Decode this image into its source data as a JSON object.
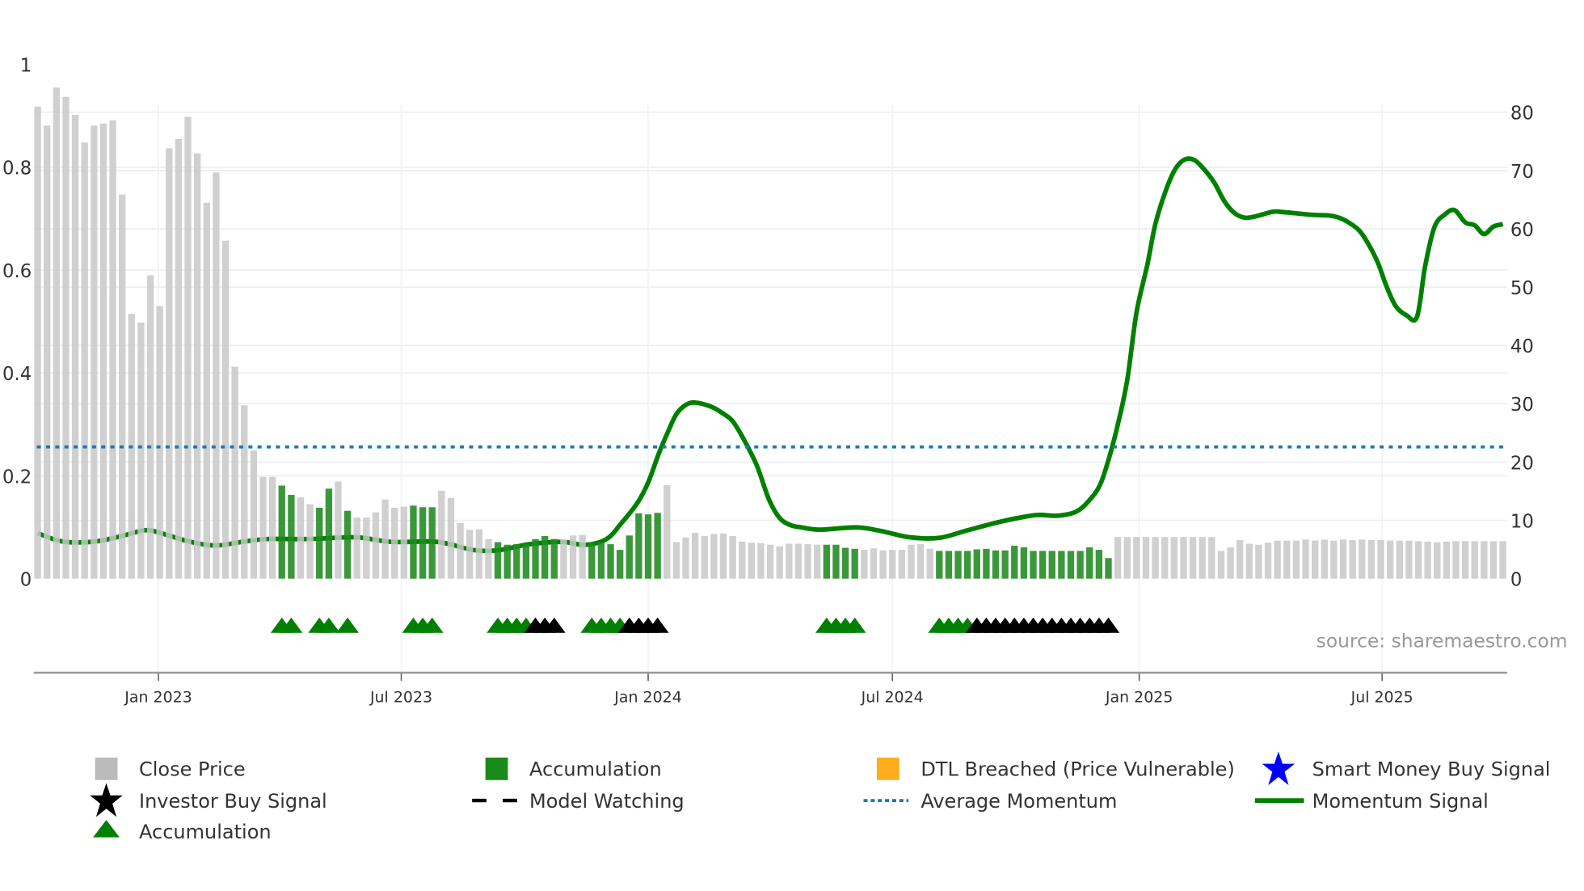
{
  "chart_data": {
    "type": "bar+line",
    "title": "",
    "source": "source: sharemaestro.com",
    "grid": true,
    "legend_placement": "bottom",
    "colors": {
      "close_price": "#c8c8c8",
      "accumulation_bar": "#1f8a1f",
      "momentum_signal": "#008000",
      "average_momentum": "#1f77b4",
      "accumulation_marker": "#008000",
      "black_marker": "#000000",
      "dtl_breached": "#ffad1f",
      "smart_money": "#0000ff"
    },
    "y_left": {
      "range": [
        0,
        1
      ],
      "ticks": [
        0,
        0.2,
        0.4,
        0.6,
        0.8,
        1
      ],
      "tick_labels": [
        "0",
        "0.2",
        "0.4",
        "0.6",
        "0.8",
        "1"
      ]
    },
    "y_right": {
      "range": [
        0,
        88.2
      ],
      "ticks": [
        0,
        10,
        20,
        30,
        40,
        50,
        60,
        70,
        80
      ],
      "tick_labels": [
        "0",
        "10",
        "20",
        "30",
        "40",
        "50",
        "60",
        "70",
        "80"
      ]
    },
    "x_ticks": [
      {
        "date": "2023-01-01",
        "label": "Jan 2023"
      },
      {
        "date": "2023-07-01",
        "label": "Jul 2023"
      },
      {
        "date": "2024-01-01",
        "label": "Jan 2024"
      },
      {
        "date": "2024-07-01",
        "label": "Jul 2024"
      },
      {
        "date": "2025-01-01",
        "label": "Jan 2025"
      },
      {
        "date": "2025-07-01",
        "label": "Jul 2025"
      }
    ],
    "dates": [
      "2022-10-03",
      "2022-10-10",
      "2022-10-17",
      "2022-10-24",
      "2022-10-31",
      "2022-11-07",
      "2022-11-14",
      "2022-11-21",
      "2022-11-28",
      "2022-12-05",
      "2022-12-12",
      "2022-12-19",
      "2022-12-26",
      "2023-01-02",
      "2023-01-09",
      "2023-01-16",
      "2023-01-23",
      "2023-01-30",
      "2023-02-06",
      "2023-02-13",
      "2023-02-20",
      "2023-02-27",
      "2023-03-06",
      "2023-03-13",
      "2023-03-20",
      "2023-03-27",
      "2023-04-03",
      "2023-04-10",
      "2023-04-17",
      "2023-04-24",
      "2023-05-01",
      "2023-05-08",
      "2023-05-15",
      "2023-05-22",
      "2023-05-29",
      "2023-06-05",
      "2023-06-12",
      "2023-06-19",
      "2023-06-26",
      "2023-07-03",
      "2023-07-10",
      "2023-07-17",
      "2023-07-24",
      "2023-07-31",
      "2023-08-07",
      "2023-08-14",
      "2023-08-21",
      "2023-08-28",
      "2023-09-04",
      "2023-09-11",
      "2023-09-18",
      "2023-09-25",
      "2023-10-02",
      "2023-10-09",
      "2023-10-16",
      "2023-10-23",
      "2023-10-30",
      "2023-11-06",
      "2023-11-13",
      "2023-11-20",
      "2023-11-27",
      "2023-12-04",
      "2023-12-11",
      "2023-12-18",
      "2023-12-25",
      "2024-01-01",
      "2024-01-08",
      "2024-01-15",
      "2024-01-22",
      "2024-01-29",
      "2024-02-05",
      "2024-02-12",
      "2024-02-19",
      "2024-02-26",
      "2024-03-04",
      "2024-03-11",
      "2024-03-18",
      "2024-03-25",
      "2024-04-01",
      "2024-04-08",
      "2024-04-15",
      "2024-04-22",
      "2024-04-29",
      "2024-05-06",
      "2024-05-13",
      "2024-05-20",
      "2024-05-27",
      "2024-06-03",
      "2024-06-10",
      "2024-06-17",
      "2024-06-24",
      "2024-07-01",
      "2024-07-08",
      "2024-07-15",
      "2024-07-22",
      "2024-07-29",
      "2024-08-05",
      "2024-08-12",
      "2024-08-19",
      "2024-08-26",
      "2024-09-02",
      "2024-09-09",
      "2024-09-16",
      "2024-09-23",
      "2024-09-30",
      "2024-10-07",
      "2024-10-14",
      "2024-10-21",
      "2024-10-28",
      "2024-11-04",
      "2024-11-11",
      "2024-11-18",
      "2024-11-25",
      "2024-12-02",
      "2024-12-09",
      "2024-12-16",
      "2024-12-23",
      "2024-12-30",
      "2025-01-06",
      "2025-01-13",
      "2025-01-20",
      "2025-01-27",
      "2025-02-03",
      "2025-02-10",
      "2025-02-17",
      "2025-02-24",
      "2025-03-03",
      "2025-03-10",
      "2025-03-17",
      "2025-03-24",
      "2025-03-31",
      "2025-04-07",
      "2025-04-14",
      "2025-04-21",
      "2025-04-28",
      "2025-05-05",
      "2025-05-12",
      "2025-05-19",
      "2025-05-26",
      "2025-06-02",
      "2025-06-09",
      "2025-06-16",
      "2025-06-23",
      "2025-06-30",
      "2025-07-07",
      "2025-07-14",
      "2025-07-21",
      "2025-07-28",
      "2025-08-04",
      "2025-08-11",
      "2025-08-18",
      "2025-08-25",
      "2025-09-01",
      "2025-09-08",
      "2025-09-15",
      "2025-09-22",
      "2025-09-29"
    ],
    "close_price": [
      0.918,
      0.881,
      0.955,
      0.937,
      0.902,
      0.848,
      0.881,
      0.885,
      0.891,
      0.747,
      0.515,
      0.498,
      0.59,
      0.53,
      0.837,
      0.855,
      0.898,
      0.827,
      0.731,
      0.79,
      0.657,
      0.412,
      0.337,
      0.249,
      0.198,
      0.198,
      0.181,
      0.163,
      0.158,
      0.145,
      0.138,
      0.175,
      0.189,
      0.132,
      0.119,
      0.119,
      0.129,
      0.154,
      0.138,
      0.14,
      0.142,
      0.139,
      0.139,
      0.171,
      0.157,
      0.108,
      0.095,
      0.096,
      0.077,
      0.071,
      0.066,
      0.067,
      0.067,
      0.077,
      0.083,
      0.077,
      0.076,
      0.084,
      0.085,
      0.071,
      0.071,
      0.067,
      0.056,
      0.084,
      0.127,
      0.125,
      0.128,
      0.182,
      0.071,
      0.08,
      0.089,
      0.083,
      0.087,
      0.088,
      0.083,
      0.072,
      0.07,
      0.069,
      0.066,
      0.063,
      0.068,
      0.068,
      0.067,
      0.066,
      0.066,
      0.066,
      0.06,
      0.058,
      0.056,
      0.059,
      0.055,
      0.056,
      0.056,
      0.066,
      0.067,
      0.058,
      0.054,
      0.054,
      0.054,
      0.054,
      0.057,
      0.058,
      0.055,
      0.055,
      0.064,
      0.061,
      0.054,
      0.054,
      0.054,
      0.054,
      0.054,
      0.054,
      0.061,
      0.056,
      0.04,
      0.081,
      0.081,
      0.081,
      0.081,
      0.081,
      0.081,
      0.081,
      0.081,
      0.081,
      0.081,
      0.081,
      0.054,
      0.061,
      0.075,
      0.068,
      0.066,
      0.07,
      0.074,
      0.074,
      0.074,
      0.076,
      0.074,
      0.076,
      0.074,
      0.076,
      0.075,
      0.076,
      0.075,
      0.075,
      0.074,
      0.074,
      0.074,
      0.073,
      0.072,
      0.071,
      0.072,
      0.073,
      0.073,
      0.073,
      0.073,
      0.073,
      0.073
    ],
    "accumulation": [
      0,
      0,
      0,
      0,
      0,
      0,
      0,
      0,
      0,
      0,
      0,
      0,
      0,
      0,
      0,
      0,
      0,
      0,
      0,
      0,
      0,
      0,
      0,
      0,
      0,
      0,
      1,
      1,
      0,
      0,
      1,
      1,
      0,
      1,
      0,
      0,
      0,
      0,
      0,
      0,
      1,
      1,
      1,
      0,
      0,
      0,
      0,
      0,
      0,
      1,
      1,
      1,
      1,
      1,
      1,
      1,
      0,
      0,
      0,
      1,
      1,
      1,
      1,
      1,
      1,
      1,
      1,
      0,
      0,
      0,
      0,
      0,
      0,
      0,
      0,
      0,
      0,
      0,
      0,
      0,
      0,
      0,
      0,
      0,
      1,
      1,
      1,
      1,
      0,
      0,
      0,
      0,
      0,
      0,
      0,
      0,
      1,
      1,
      1,
      1,
      1,
      1,
      1,
      1,
      1,
      1,
      1,
      1,
      1,
      1,
      1,
      1,
      1,
      1,
      1,
      0,
      0,
      0,
      0,
      0,
      0,
      0,
      0,
      0,
      0,
      0,
      0,
      0,
      0,
      0,
      0,
      0,
      0,
      0,
      0,
      0,
      0,
      0,
      0,
      0,
      0,
      0,
      0,
      0,
      0,
      0,
      0,
      0,
      0,
      0,
      0,
      0,
      0,
      0,
      0,
      0,
      0
    ],
    "average_momentum": 22.6,
    "momentum_signal": [
      [
        "2022-10-03",
        7.8
      ],
      [
        "2022-10-21",
        6.4
      ],
      [
        "2022-11-12",
        6.3
      ],
      [
        "2022-12-01",
        7.1
      ],
      [
        "2022-12-22",
        8.3
      ],
      [
        "2023-01-03",
        7.8
      ],
      [
        "2023-01-25",
        6.3
      ],
      [
        "2023-02-13",
        5.7
      ],
      [
        "2023-03-04",
        6.3
      ],
      [
        "2023-03-23",
        6.8
      ],
      [
        "2023-04-24",
        6.8
      ],
      [
        "2023-05-28",
        7.1
      ],
      [
        "2023-06-24",
        6.3
      ],
      [
        "2023-07-28",
        6.3
      ],
      [
        "2023-08-24",
        4.9
      ],
      [
        "2023-09-12",
        4.9
      ],
      [
        "2023-10-04",
        5.9
      ],
      [
        "2023-10-29",
        6.3
      ],
      [
        "2023-11-15",
        5.8
      ],
      [
        "2023-12-01",
        6.8
      ],
      [
        "2023-12-12",
        9.5
      ],
      [
        "2023-12-24",
        13.0
      ],
      [
        "2024-01-01",
        16.5
      ],
      [
        "2024-01-09",
        21.5
      ],
      [
        "2024-01-16",
        25.3
      ],
      [
        "2024-01-22",
        28.2
      ],
      [
        "2024-01-29",
        29.8
      ],
      [
        "2024-02-05",
        30.2
      ],
      [
        "2024-02-17",
        29.5
      ],
      [
        "2024-02-26",
        28.3
      ],
      [
        "2024-03-04",
        27.0
      ],
      [
        "2024-03-12",
        24.0
      ],
      [
        "2024-03-22",
        19.4
      ],
      [
        "2024-03-31",
        13.6
      ],
      [
        "2024-04-08",
        10.4
      ],
      [
        "2024-04-16",
        9.2
      ],
      [
        "2024-04-24",
        8.8
      ],
      [
        "2024-05-08",
        8.4
      ],
      [
        "2024-06-04",
        8.8
      ],
      [
        "2024-06-22",
        8.2
      ],
      [
        "2024-07-14",
        7.1
      ],
      [
        "2024-08-05",
        7.0
      ],
      [
        "2024-08-26",
        8.3
      ],
      [
        "2024-09-22",
        9.9
      ],
      [
        "2024-10-16",
        10.9
      ],
      [
        "2024-11-01",
        10.8
      ],
      [
        "2024-11-15",
        11.5
      ],
      [
        "2024-11-25",
        13.5
      ],
      [
        "2024-12-03",
        16.2
      ],
      [
        "2024-12-10",
        21.1
      ],
      [
        "2024-12-16",
        26.4
      ],
      [
        "2024-12-23",
        34.0
      ],
      [
        "2024-12-30",
        45.7
      ],
      [
        "2025-01-07",
        53.8
      ],
      [
        "2025-01-13",
        60.8
      ],
      [
        "2025-01-21",
        66.7
      ],
      [
        "2025-01-28",
        70.3
      ],
      [
        "2025-02-04",
        71.9
      ],
      [
        "2025-02-11",
        71.8
      ],
      [
        "2025-02-18",
        70.3
      ],
      [
        "2025-02-26",
        67.9
      ],
      [
        "2025-03-05",
        64.9
      ],
      [
        "2025-03-12",
        62.9
      ],
      [
        "2025-03-19",
        62.0
      ],
      [
        "2025-03-26",
        62.0
      ],
      [
        "2025-04-10",
        62.9
      ],
      [
        "2025-04-17",
        62.9
      ],
      [
        "2025-05-10",
        62.4
      ],
      [
        "2025-05-22",
        62.3
      ],
      [
        "2025-05-30",
        61.9
      ],
      [
        "2025-06-06",
        61.1
      ],
      [
        "2025-06-14",
        59.7
      ],
      [
        "2025-06-21",
        57.3
      ],
      [
        "2025-06-28",
        54.1
      ],
      [
        "2025-07-04",
        50.3
      ],
      [
        "2025-07-11",
        46.8
      ],
      [
        "2025-07-19",
        45.2
      ],
      [
        "2025-07-27",
        44.9
      ],
      [
        "2025-08-02",
        53.5
      ],
      [
        "2025-08-09",
        60.3
      ],
      [
        "2025-08-17",
        62.5
      ],
      [
        "2025-08-24",
        63.2
      ],
      [
        "2025-09-01",
        61.1
      ],
      [
        "2025-09-08",
        60.6
      ],
      [
        "2025-09-15",
        59.1
      ],
      [
        "2025-09-22",
        60.4
      ],
      [
        "2025-09-29",
        60.8
      ]
    ],
    "accumulation_markers": [
      "2023-04-03",
      "2023-04-10",
      "2023-05-01",
      "2023-05-08",
      "2023-05-22",
      "2023-07-10",
      "2023-07-17",
      "2023-07-24",
      "2023-09-11",
      "2023-09-18",
      "2023-09-25",
      "2023-10-02",
      "2023-11-20",
      "2023-11-27",
      "2023-12-04",
      "2023-12-11",
      "2024-05-13",
      "2024-05-20",
      "2024-05-27",
      "2024-06-03",
      "2024-08-05",
      "2024-08-12",
      "2024-08-19",
      "2024-08-26"
    ],
    "black_markers": [
      "2023-10-09",
      "2023-10-16",
      "2023-10-23",
      "2023-12-18",
      "2023-12-25",
      "2024-01-01",
      "2024-01-08",
      "2024-09-02",
      "2024-09-09",
      "2024-09-16",
      "2024-09-23",
      "2024-09-30",
      "2024-10-07",
      "2024-10-14",
      "2024-10-21",
      "2024-10-28",
      "2024-11-04",
      "2024-11-11",
      "2024-11-18",
      "2024-11-25",
      "2024-12-02",
      "2024-12-09"
    ],
    "legend": [
      {
        "label": "Close Price",
        "icon": "grey-square"
      },
      {
        "label": "Accumulation",
        "icon": "green-square"
      },
      {
        "label": "DTL Breached (Price Vulnerable)",
        "icon": "orange-square"
      },
      {
        "label": "Smart Money Buy Signal",
        "icon": "blue-star"
      },
      {
        "label": "Investor Buy Signal",
        "icon": "black-star"
      },
      {
        "label": "Model Watching",
        "icon": "black-dashed-line"
      },
      {
        "label": "Average Momentum",
        "icon": "blue-dotted-line"
      },
      {
        "label": "Momentum Signal",
        "icon": "green-solid-line"
      },
      {
        "label": "Accumulation",
        "icon": "green-triangle"
      }
    ]
  }
}
